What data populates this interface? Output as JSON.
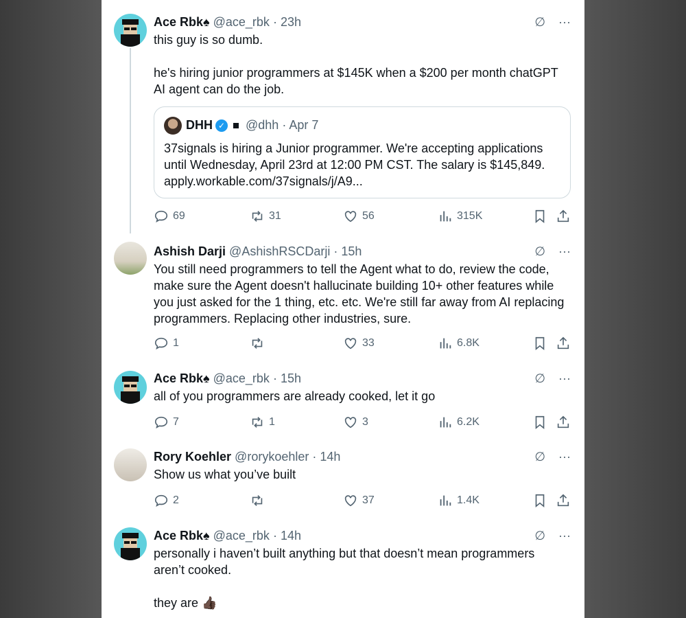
{
  "tweets": [
    {
      "name": "Ace Rbk♠",
      "handle": "@ace_rbk",
      "time": "23h",
      "text": "this guy is so dumb.\n\nhe's hiring junior programmers at $145K when a $200 per month chatGPT AI agent can do the job.",
      "quote": {
        "name": "DHH",
        "handle": "@dhh",
        "time": "Apr 7",
        "text": "37signals is hiring a Junior programmer. We're accepting applications until Wednesday, April 23rd at 12:00 PM CST. The salary is $145,849. apply.workable.com/37signals/j/A9..."
      },
      "stats": {
        "replies": "69",
        "reposts": "31",
        "likes": "56",
        "views": "315K"
      }
    },
    {
      "name": "Ashish Darji",
      "handle": "@AshishRSCDarji",
      "time": "15h",
      "text": "You still need programmers to tell the Agent what to do, review the code, make sure the Agent doesn't hallucinate building 10+ other features while you just asked for the 1 thing, etc. etc. We're still far away from AI replacing programmers. Replacing other industries, sure.",
      "stats": {
        "replies": "1",
        "reposts": "",
        "likes": "33",
        "views": "6.8K"
      }
    },
    {
      "name": "Ace Rbk♠",
      "handle": "@ace_rbk",
      "time": "15h",
      "text": "all of you programmers are already cooked, let it go",
      "stats": {
        "replies": "7",
        "reposts": "1",
        "likes": "3",
        "views": "6.2K"
      }
    },
    {
      "name": "Rory Koehler",
      "handle": "@rorykoehler",
      "time": "14h",
      "text": "Show us what you’ve built",
      "stats": {
        "replies": "2",
        "reposts": "",
        "likes": "37",
        "views": "1.4K"
      }
    },
    {
      "name": "Ace Rbk♠",
      "handle": "@ace_rbk",
      "time": "14h",
      "text": "personally i haven’t built anything but that doesn’t mean programmers aren’t cooked.\n\nthey are 👍🏿"
    }
  ],
  "icons": {
    "grok": "∅",
    "more": "···"
  },
  "colors": {
    "secondary": "#536471",
    "border": "#cfd9de",
    "verified": "#1d9bf0"
  }
}
